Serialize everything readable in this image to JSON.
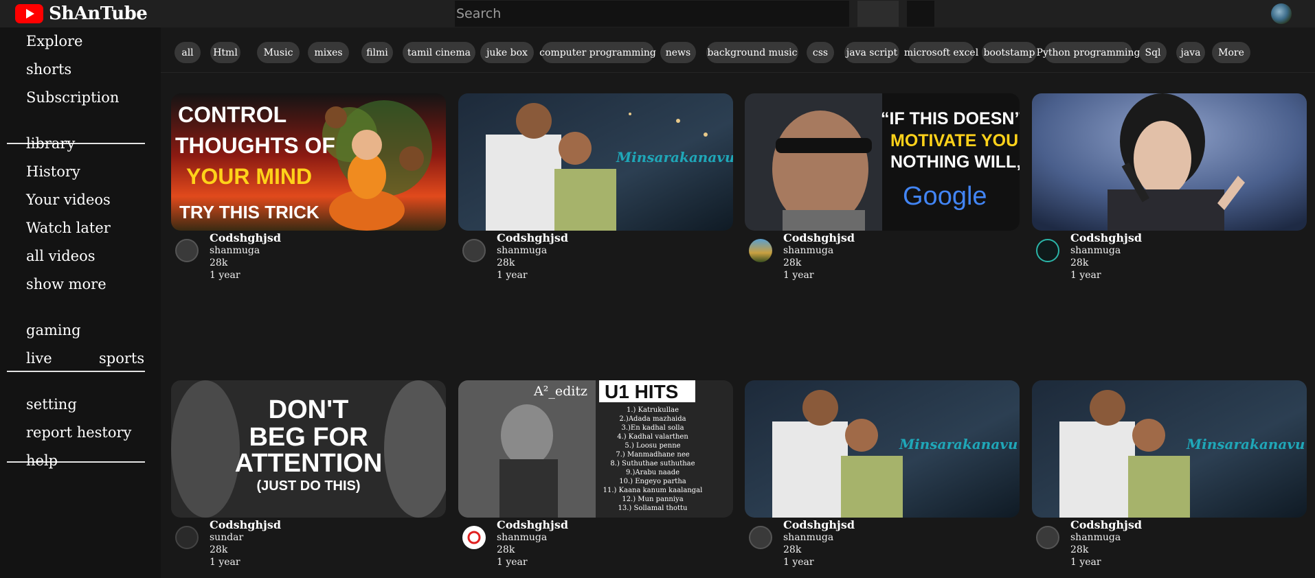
{
  "app": {
    "title": "ShAnTube",
    "logo_icon": "youtube-play-icon",
    "brand_color": "#ff0000"
  },
  "search": {
    "placeholder": "Search",
    "value": ""
  },
  "sidebar": {
    "groups": [
      [
        "Explore",
        "shorts",
        "Subscription"
      ],
      [
        "library",
        "History",
        "Your videos",
        "Watch later",
        "all videos",
        "show more"
      ],
      [
        "gaming",
        "live",
        "sports"
      ],
      [
        "setting",
        "report hestory",
        "help"
      ]
    ]
  },
  "chips": [
    "all",
    "Html",
    "Music",
    "mixes",
    "filmi",
    "tamil cinema",
    "juke box",
    "computer programming",
    "news",
    "background music",
    "css",
    "java script",
    "microsoft excel",
    "bootstamp",
    "Python programming",
    "Sql",
    "java",
    "More"
  ],
  "videos": [
    {
      "title": "Codshghjsd",
      "channel": "shanmuga",
      "views": "28k",
      "age": "1 year",
      "thumb_text": [
        "CONTROL",
        "THOUGHTS OF",
        "YOUR MIND",
        "TRY THIS TRICK"
      ]
    },
    {
      "title": "Codshghjsd",
      "channel": "shanmuga",
      "views": "28k",
      "age": "1 year",
      "thumb_text": [
        "Minsarakanavu"
      ]
    },
    {
      "title": "Codshghjsd",
      "channel": "shanmuga",
      "views": "28k",
      "age": "1 year",
      "thumb_text": [
        "“IF THIS DOESN’T",
        "MOTIVATE YOU",
        "NOTHING WILL„",
        "Google"
      ]
    },
    {
      "title": "Codshghjsd",
      "channel": "shanmuga",
      "views": "28k",
      "age": "1 year",
      "thumb_text": []
    },
    {
      "title": "Codshghjsd",
      "channel": "sundar",
      "views": "28k",
      "age": "1 year",
      "thumb_text": [
        "DON'T",
        "BEG FOR",
        "ATTENTION",
        "(JUST DO THIS)"
      ]
    },
    {
      "title": "Codshghjsd",
      "channel": "shanmuga",
      "views": "28k",
      "age": "1 year",
      "thumb_text": [
        "A²_editz",
        "U1 HITS",
        "1.) Katrukullae",
        "2.)Adada mazhaida",
        "3.)En kadhal solla",
        "4.) Kadhal valarthen",
        "5.) Loosu penne",
        "7.) Manmadhane nee",
        "8.) Suthuthae suthuthae",
        "9.)Arabu naade",
        "10.) Engeyo partha",
        "11.) Kaana kanum kaalangal",
        "12.) Mun panniya",
        "13.) Sollamal thottu"
      ]
    },
    {
      "title": "Codshghjsd",
      "channel": "shanmuga",
      "views": "28k",
      "age": "1 year",
      "thumb_text": [
        "Minsarakanavu"
      ]
    },
    {
      "title": "Codshghjsd",
      "channel": "shanmuga",
      "views": "28k",
      "age": "1 year",
      "thumb_text": [
        "Minsarakanavu"
      ]
    }
  ],
  "colors": {
    "background": "#181818",
    "topbar": "#202020",
    "sidebar": "#131313",
    "chip": "#383838",
    "accent_yellow": "#ffd21a",
    "teal": "#1fa7b8"
  }
}
